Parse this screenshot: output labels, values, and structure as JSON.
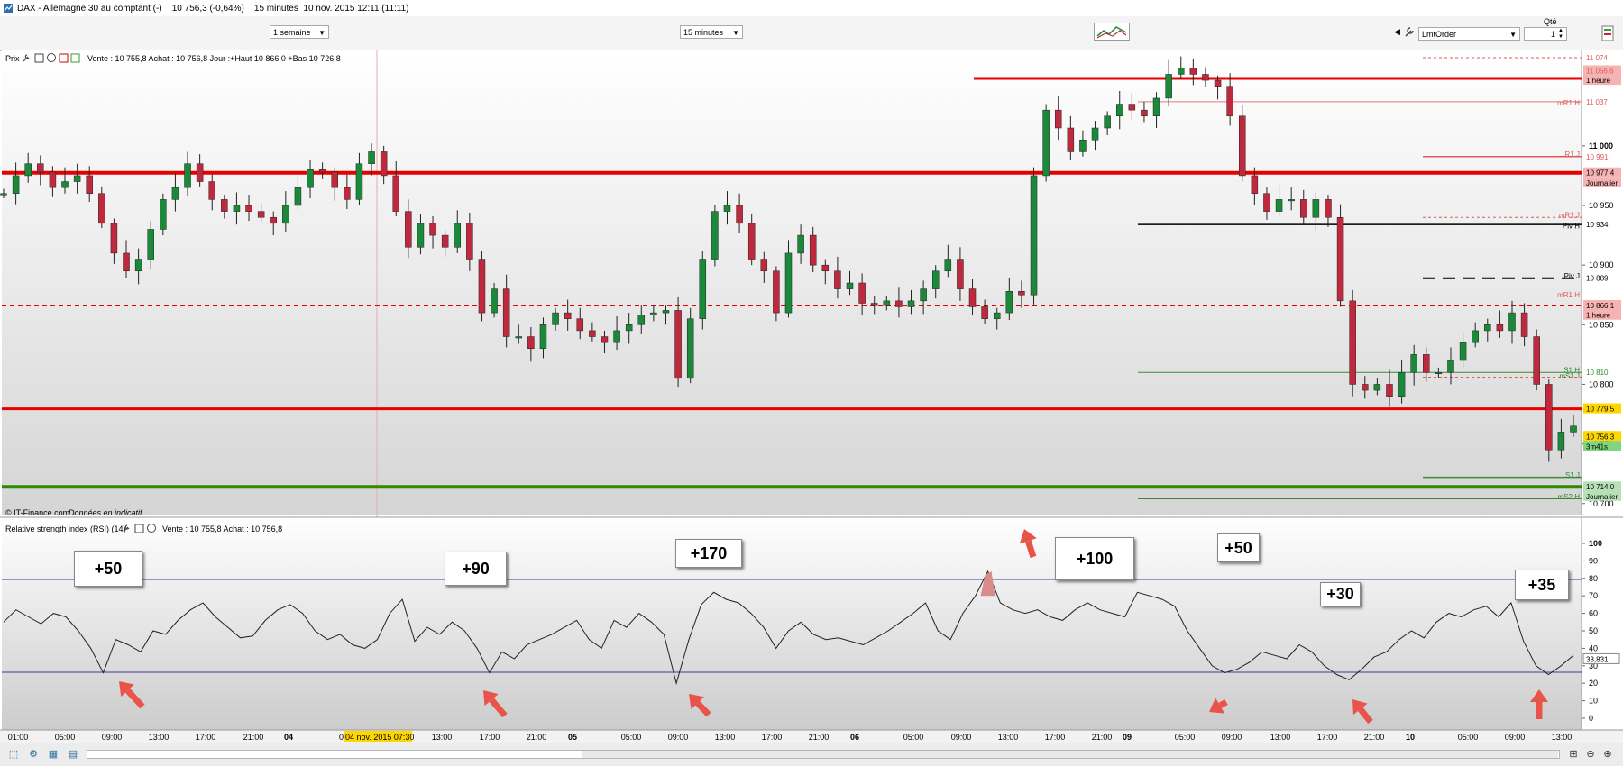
{
  "window": {
    "title": "DAX - Allemagne 30 au comptant (-)    10 756,3 (-0,64%)    15 minutes  10 nov. 2015 12:11 (11:11)"
  },
  "toolbar": {
    "period_select": "1 semaine",
    "interval_select": "15 minutes",
    "order_type": "LmtOrder",
    "qty_label": "Qté",
    "qty_value": "1"
  },
  "price_panel": {
    "header": "Prix",
    "info": "Vente : 10 755,8 Achat : 10 756,8 Jour :+Haut 10 866,0 +Bas 10 726,8",
    "footer_source": "© IT-Finance.com",
    "footer_note": "Données en indicatif",
    "y_ticks": [
      "11 000",
      "10 950",
      "10 900",
      "10 850",
      "10 800",
      "10 750",
      "10 700"
    ],
    "y_labels": [
      {
        "text": "11 074",
        "color": "#e05a5a"
      },
      {
        "text": "11 056,6",
        "color": "#e05a5a",
        "bg": "#f5b3b3"
      },
      {
        "text": "1 heure",
        "color": "#000",
        "bg": "#f5b3b3"
      },
      {
        "text": "11 037",
        "color": "#e05a5a"
      },
      {
        "text": "10 991",
        "color": "#e05a5a"
      },
      {
        "text": "10 977,4",
        "color": "#000",
        "bg": "#f5b3b3"
      },
      {
        "text": "Journalier",
        "color": "#000",
        "bg": "#f5b3b3"
      },
      {
        "text": "10 934",
        "color": "#000"
      },
      {
        "text": "10 889",
        "color": "#000"
      },
      {
        "text": "10 866,1",
        "color": "#000",
        "bg": "#f5b3b3"
      },
      {
        "text": "1 heure",
        "color": "#000",
        "bg": "#f5b3b3"
      },
      {
        "text": "10 810",
        "color": "#2e8b2e"
      },
      {
        "text": "10 779,5",
        "color": "#000",
        "bg": "#ffd700"
      },
      {
        "text": "10 756,3",
        "color": "#000",
        "bg": "#ffd700"
      },
      {
        "text": "3m41s",
        "color": "#000",
        "bg": "#7fd67f"
      },
      {
        "text": "10 714,0",
        "color": "#000",
        "bg": "#b8e0b8"
      },
      {
        "text": "Journalier",
        "color": "#000",
        "bg": "#b8e0b8"
      }
    ],
    "pivot_labels": [
      "mR1 H",
      "R1 J",
      "mR1 J",
      "Piv H",
      "Piv J",
      "mR1 H",
      "S1 H",
      "mS1 J",
      "S1 J",
      "mS2 H"
    ]
  },
  "rsi_panel": {
    "header": "Relative strength index (RSI) (14)",
    "info": "Vente : 10 755,8 Achat : 10 756,8",
    "y_ticks": [
      "100",
      "90",
      "80",
      "70",
      "60",
      "50",
      "40",
      "30",
      "20",
      "10",
      "0"
    ],
    "current": "33,831",
    "callouts": [
      "+50",
      "+90",
      "+170",
      "+100",
      "+50",
      "+30",
      "+35"
    ]
  },
  "x_axis": {
    "labels": [
      "01:00",
      "05:00",
      "09:00",
      "13:00",
      "17:00",
      "21:00",
      "04",
      "13:00",
      "17:00",
      "21:00",
      "05",
      "05:00",
      "09:00",
      "13:00",
      "17:00",
      "21:00",
      "06",
      "05:00",
      "09:00",
      "13:00",
      "17:00",
      "21:00",
      "09",
      "05:00",
      "09:00",
      "13:00",
      "17:00",
      "21:00",
      "10",
      "05:00",
      "09:00",
      "13:00"
    ],
    "cursor_label": "04 nov. 2015 07:30",
    "cursor_prefix": "0"
  },
  "colors": {
    "bull": "#1a8a3a",
    "bear": "#c0283e",
    "resistance": "#e60000",
    "support": "#2e8b00",
    "rsi_band": "#3a3aaa"
  },
  "chart_data": [
    {
      "type": "line",
      "title": "DAX 15 minutes",
      "ylim": [
        10690,
        11080
      ],
      "series": [
        {
          "values": [
            10960,
            10975,
            10985,
            10978,
            10965,
            10970,
            10975,
            10960,
            10935,
            10910,
            10895,
            10905,
            10930,
            10955,
            10965,
            10985,
            10970,
            10955,
            10945,
            10950,
            10945,
            10940,
            10935,
            10950,
            10965,
            10980,
            10978,
            10965,
            10955,
            10985,
            10995,
            10975,
            10945,
            10915,
            10935,
            10925,
            10915,
            10935,
            10905,
            10860,
            10880,
            10840,
            10840,
            10830,
            10850,
            10860,
            10855,
            10845,
            10840,
            10835,
            10845,
            10850,
            10858,
            10860,
            10862,
            10805,
            10855,
            10905,
            10945,
            10950,
            10935,
            10905,
            10895,
            10860,
            10910,
            10925,
            10900,
            10895,
            10880,
            10885,
            10868,
            10866,
            10870,
            10865,
            10870,
            10880,
            10895,
            10905,
            10880,
            10865,
            10855,
            10860,
            10878,
            10875,
            10975,
            11030,
            11015,
            10995,
            11005,
            11015,
            11025,
            11035,
            11030,
            11025,
            11040,
            11060,
            11065,
            11060,
            11055,
            11050,
            11025,
            10975,
            10960,
            10945,
            10955,
            10955,
            10940,
            10955,
            10940,
            10870,
            10800,
            10795,
            10800,
            10790,
            10810,
            10825,
            10810,
            10810,
            10820,
            10835,
            10845,
            10850,
            10845,
            10860,
            10840,
            10800,
            10745,
            10760,
            10765
          ]
        }
      ]
    },
    {
      "type": "line",
      "title": "Relative strength index (RSI) (14)",
      "ylim": [
        0,
        100
      ],
      "series": [
        {
          "values": [
            55,
            62,
            58,
            54,
            60,
            58,
            50,
            40,
            26,
            45,
            42,
            38,
            50,
            48,
            56,
            62,
            66,
            58,
            52,
            46,
            47,
            56,
            62,
            65,
            60,
            50,
            45,
            48,
            42,
            40,
            45,
            60,
            68,
            44,
            52,
            48,
            55,
            50,
            40,
            26,
            38,
            34,
            42,
            45,
            48,
            52,
            56,
            45,
            40,
            56,
            52,
            60,
            55,
            48,
            20,
            45,
            65,
            72,
            68,
            66,
            60,
            52,
            40,
            50,
            55,
            48,
            45,
            46,
            44,
            42,
            46,
            50,
            55,
            60,
            66,
            50,
            45,
            60,
            70,
            84,
            66,
            62,
            60,
            62,
            58,
            56,
            62,
            66,
            62,
            60,
            58,
            72,
            70,
            68,
            64,
            50,
            40,
            30,
            26,
            28,
            32,
            38,
            36,
            34,
            42,
            38,
            30,
            25,
            22,
            28,
            35,
            38,
            45,
            50,
            46,
            55,
            60,
            58,
            62,
            64,
            58,
            66,
            44,
            30,
            25,
            30,
            36
          ]
        }
      ]
    }
  ]
}
